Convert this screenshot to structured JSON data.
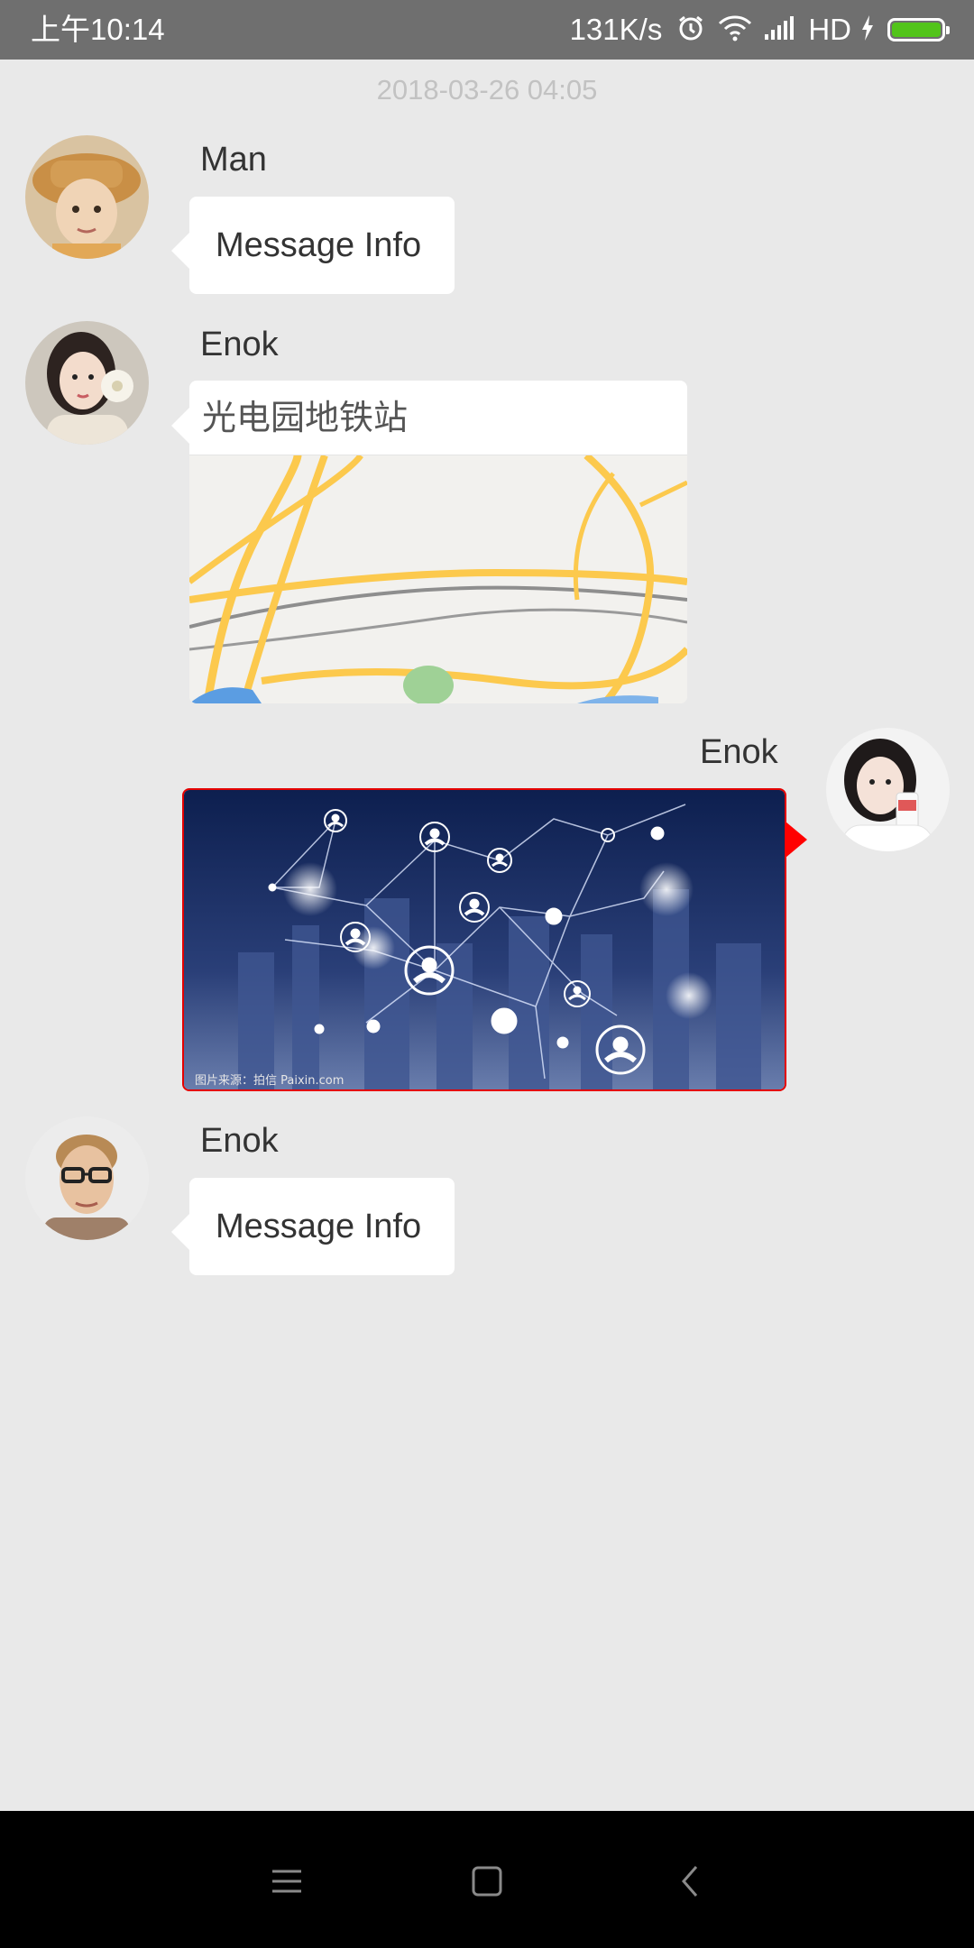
{
  "status_bar": {
    "time": "上午10:14",
    "net_speed": "131K/s",
    "network_label": "HD",
    "icons": [
      "alarm-icon",
      "wifi-icon",
      "signal-icon",
      "charging-icon",
      "battery-icon"
    ],
    "battery_color": "#52c41a",
    "battery_level": 1.0
  },
  "chat": {
    "timestamp": "2018-03-26 04:05",
    "messages": [
      {
        "sender": "Man",
        "type": "text",
        "text": "Message Info"
      },
      {
        "sender": "Enok",
        "type": "location",
        "place": "光电园地铁站"
      },
      {
        "sender": "Enok",
        "type": "image",
        "caption": "图片来源：拍信 Paixin.com",
        "direction": "sent"
      },
      {
        "sender": "Enok",
        "type": "text",
        "text": "Message Info"
      }
    ]
  },
  "nav_bar": {
    "buttons": [
      "menu-icon",
      "home-icon",
      "back-icon"
    ]
  },
  "colors": {
    "background": "#e9e9e9",
    "status_bar": "#6f6f6f",
    "bubble": "#ffffff",
    "sent_highlight": "#ff0000"
  }
}
